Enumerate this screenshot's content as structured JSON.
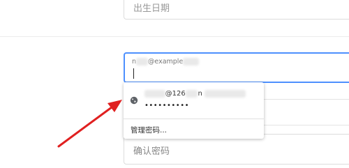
{
  "birth_field": {
    "placeholder": "出生日期"
  },
  "email_field": {
    "floating_label_prefix": "n",
    "floating_label_suffix": "@example"
  },
  "autofill_popup": {
    "account_text": "@126",
    "account_suffix": "n",
    "password_mask": "••••••••••",
    "manage_label": "管理密码..."
  },
  "confirm_field": {
    "placeholder": "确认密码"
  },
  "colors": {
    "focus_border": "#4d90fe",
    "annotation_arrow": "#e02020"
  },
  "icons": {
    "site_icon": "globe-icon"
  }
}
